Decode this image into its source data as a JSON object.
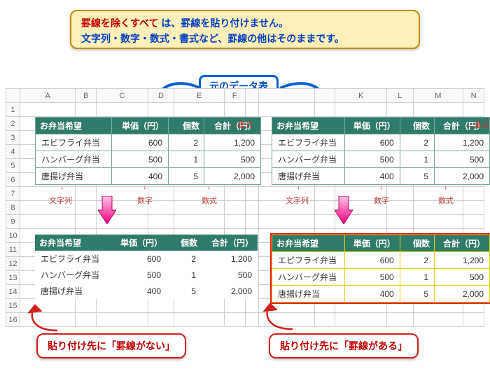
{
  "topbox": {
    "line1_strong": "罫線を除くすべて",
    "line1_rest": "は、罫線を貼り付けません。",
    "line2": "文字列・数字・数式・書式など、罫線の他はそのままです。"
  },
  "source_label": "元のデータ表",
  "format_annot": "←書式",
  "columns": [
    "A",
    "B",
    "C",
    "D",
    "E",
    "F",
    "",
    "",
    "",
    "",
    "K",
    "L",
    "M",
    "N"
  ],
  "row_headers": [
    "1",
    "2",
    "3",
    "4",
    "5",
    "6",
    "7",
    "8",
    "9",
    "10",
    "11",
    "12",
    "13",
    "14",
    "15",
    "16"
  ],
  "xltable": {
    "headers": {
      "name": "お弁当希望",
      "price": "単価（円）",
      "qty": "個数",
      "total": "合計（円）"
    },
    "rows": [
      {
        "name": "エビフライ弁当",
        "price": "600",
        "qty": "2",
        "total": "1,200"
      },
      {
        "name": "ハンバーグ弁当",
        "price": "500",
        "qty": "1",
        "total": "500"
      },
      {
        "name": "唐揚げ弁当",
        "price": "400",
        "qty": "5",
        "total": "2,000"
      }
    ]
  },
  "dtypes": {
    "text": "文字列",
    "num": "数字",
    "formula": "数式"
  },
  "badge_left": "貼り付け先に「罫線がない」",
  "badge_right": "貼り付け先に「罫線がある」"
}
